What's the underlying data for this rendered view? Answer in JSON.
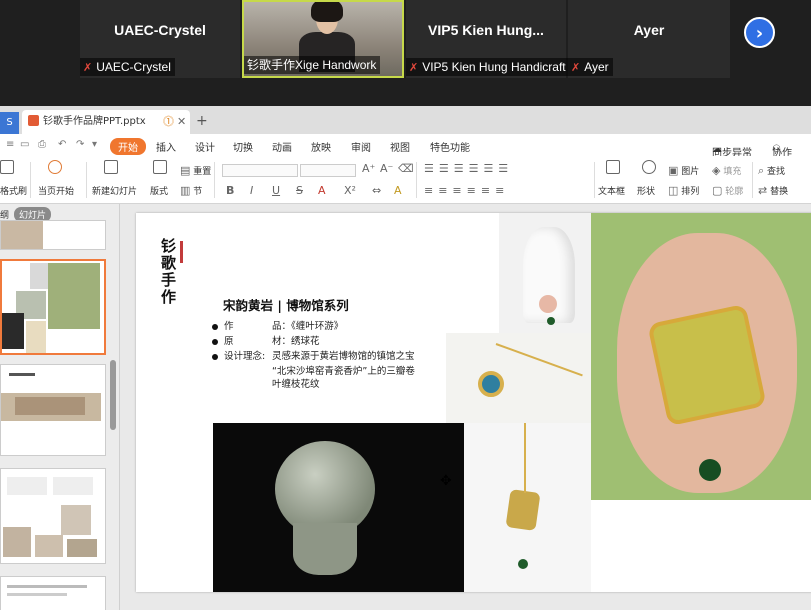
{
  "meeting": {
    "participants": [
      {
        "name": "UAEC-Crystel",
        "label": "UAEC-Crystel",
        "muted": true
      },
      {
        "name": "",
        "label": "钐歌手作Xige Handwork",
        "muted": false,
        "active": true
      },
      {
        "name": "VIP5 Kien Hung...",
        "label": "VIP5 Kien Hung Handicraft",
        "muted": true
      },
      {
        "name": "Ayer",
        "label": "Ayer",
        "muted": true
      }
    ],
    "next_icon": "chevron-right-icon"
  },
  "tabs": {
    "left_tab": "S",
    "doc_name": "钐歌手作品牌PPT.pptx",
    "new_tab": "+"
  },
  "menu": {
    "items": [
      "开始",
      "插入",
      "设计",
      "切换",
      "动画",
      "放映",
      "审阅",
      "视图",
      "特色功能"
    ],
    "right": [
      "同步异常",
      "协作"
    ]
  },
  "ribbon": {
    "format": "格式刷",
    "from_current": "当页开始",
    "new_slide": "新建幻灯片",
    "layout": "版式",
    "section": "节",
    "reset": "重置",
    "textbox": "文本框",
    "shape": "形状",
    "picture": "图片",
    "fill": "填充",
    "arrange": "排列",
    "outline": "轮廓",
    "find": "查找",
    "replace": "替换",
    "font_buttons": [
      "B",
      "I",
      "U",
      "S",
      "A",
      "X²",
      "A"
    ]
  },
  "left_panel": {
    "outline_tab": "纲",
    "slides_tab": "幻灯片"
  },
  "slide": {
    "brand_lines": [
      "钐",
      "歌",
      "手",
      "作"
    ],
    "title": "宋韵黄岩 | 博物馆系列",
    "rows": [
      {
        "key": "作",
        "value": "品：《缠叶环游》"
      },
      {
        "key": "原",
        "value": "材：绣球花"
      },
      {
        "key": "设计理念:",
        "value": "灵感来源于黄岩博物馆的镇馆之宝"
      }
    ],
    "continuation": [
      "“北宋沙埠窑青瓷香炉”上的三瓣卷",
      "叶缠枝花纹"
    ]
  },
  "colors": {
    "accent_orange": "#f0762e",
    "selection_border": "#c6d94a",
    "next_button": "#2f6fe4",
    "muted_mic": "#e3483c"
  }
}
